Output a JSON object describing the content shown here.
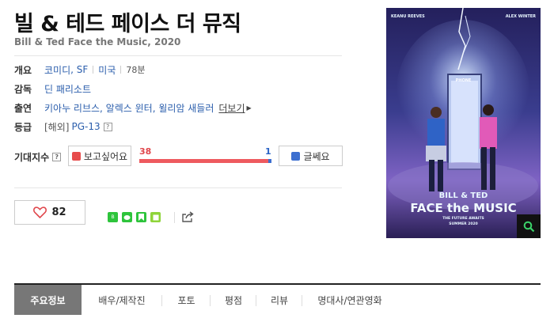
{
  "movie": {
    "title": "빌 & 테드 페이스 더 뮤직",
    "subtitle": "Bill & Ted Face the Music, 2020"
  },
  "info": {
    "overview_label": "개요",
    "genres": [
      "코미디",
      "SF"
    ],
    "country": "미국",
    "runtime": "78분",
    "director_label": "감독",
    "director": "딘 패리소트",
    "cast_label": "출연",
    "cast": "키아누 리브스, 알렉스 윈터, 윌리암 새들러",
    "cast_more": "더보기",
    "rating_label": "등급",
    "rating_prefix": "[해외]",
    "rating": "PG-13",
    "help_mark": "?"
  },
  "expect": {
    "label": "기대지수",
    "want_button": "보고싶어요",
    "bad_button": "글쎄요",
    "want_count": "38",
    "bad_count": "1",
    "want_ratio": 0.974,
    "want_color": "#ee5a5f",
    "bad_color": "#3d6fd0"
  },
  "like": {
    "count": "82"
  },
  "share_icons": [
    "band-icon",
    "line-icon",
    "bookmark-icon",
    "memo-icon",
    "share-out-icon"
  ],
  "poster": {
    "cast_left": "KEANU REEVES",
    "cast_right": "ALEX WINTER",
    "booth_sign": "PHONE",
    "title_top": "BILL & TED",
    "title_main": "FACE the MUSIC",
    "tagline": "THE FUTURE AWAITS",
    "release": "SUMMER 2020"
  },
  "tabs": [
    "주요정보",
    "배우/제작진",
    "포토",
    "평점",
    "리뷰",
    "명대사/연관영화"
  ]
}
